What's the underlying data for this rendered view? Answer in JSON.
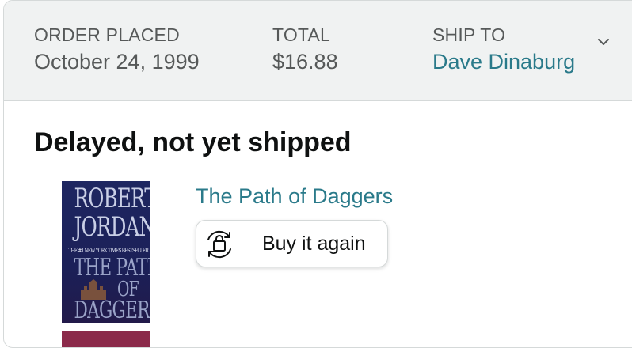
{
  "order": {
    "placed_label": "ORDER PLACED",
    "placed_value": "October 24, 1999",
    "total_label": "TOTAL",
    "total_value": "$16.88",
    "ship_label": "SHIP TO",
    "ship_value": "Dave Dinaburg"
  },
  "shipment": {
    "status": "Delayed, not yet shipped"
  },
  "item": {
    "title": "The Path of Daggers",
    "buy_again_label": "Buy it again",
    "cover": {
      "author_line1": "ROBERT",
      "author_line2": "JORDAN",
      "badge": "THE #1 NEW YORK TIMES BESTSELLER",
      "title_line1": "THE PATH",
      "title_line2": "OF",
      "title_line3": "DAGGERS"
    }
  },
  "colors": {
    "link": "#2a7a8a",
    "header_bg": "#f0f2f2",
    "text": "#0f1111",
    "muted": "#565959"
  },
  "icons": {
    "ship_dropdown": "chevron-down-icon",
    "buy_again": "buy-again-icon"
  }
}
